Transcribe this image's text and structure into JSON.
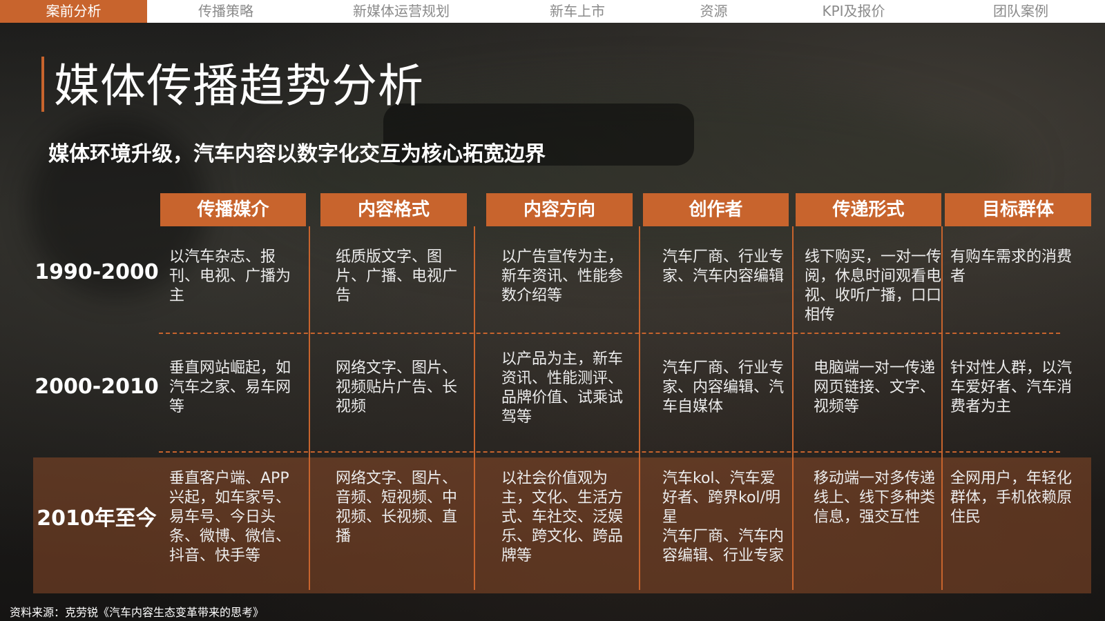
{
  "nav": {
    "tabs": [
      {
        "label": "案前分析",
        "active": true
      },
      {
        "label": "传播策略",
        "active": false
      },
      {
        "label": "新媒体运营规划",
        "active": false
      },
      {
        "label": "新车上市",
        "active": false
      },
      {
        "label": "资源",
        "active": false
      },
      {
        "label": "KPI及报价",
        "active": false
      },
      {
        "label": "团队案例",
        "active": false
      }
    ]
  },
  "header": {
    "title": "媒体传播趋势分析",
    "subtitle": "媒体环境升级，汽车内容以数字化交互为核心拓宽边界"
  },
  "table": {
    "columns": [
      "传播媒介",
      "内容格式",
      "内容方向",
      "创作者",
      "传递形式",
      "目标群体"
    ],
    "rows": [
      {
        "period": "1990-2000",
        "cells": [
          "以汽车杂志、报刊、电视、广播为主",
          "纸质版文字、图片、广播、电视广告",
          "以广告宣传为主，新车资讯、性能参数介绍等",
          "汽车厂商、行业专家、汽车内容编辑",
          "线下购买，一对一传阅，休息时间观看电视、收听广播，口口相传",
          "有购车需求的消费者"
        ]
      },
      {
        "period": "2000-2010",
        "cells": [
          "垂直网站崛起，如汽车之家、易车网等",
          "网络文字、图片、视频贴片广告、长视频",
          "以产品为主，新车资讯、性能测评、品牌价值、试乘试驾等",
          "汽车厂商、行业专家、内容编辑、汽车自媒体",
          "电脑端一对一传递网页链接、文字、视频等",
          "针对性人群，以汽车爱好者、汽车消费者为主"
        ]
      },
      {
        "period": "2010年至今",
        "cells": [
          "垂直客户端、APP兴起，如车家号、易车号、今日头条、微博、微信、抖音、快手等",
          "网络文字、图片、音频、短视频、中视频、长视频、直播",
          "以社会价值观为主，文化、生活方式、车社交、泛娱乐、跨文化、跨品牌等",
          "汽车kol、汽车爱好者、跨界kol/明星\n汽车厂商、汽车内容编辑、行业专家",
          "移动端一对多传递线上、线下多种类信息，强交互性",
          "全网用户，年轻化群体，手机依赖原住民"
        ]
      }
    ]
  },
  "footer": {
    "source": "资料来源：克劳锐《汽车内容生态变革带来的思考》"
  },
  "colors": {
    "accent": "#c8642d",
    "nav_bg": "#ffffff",
    "nav_inactive_text": "#8a8a8a"
  }
}
